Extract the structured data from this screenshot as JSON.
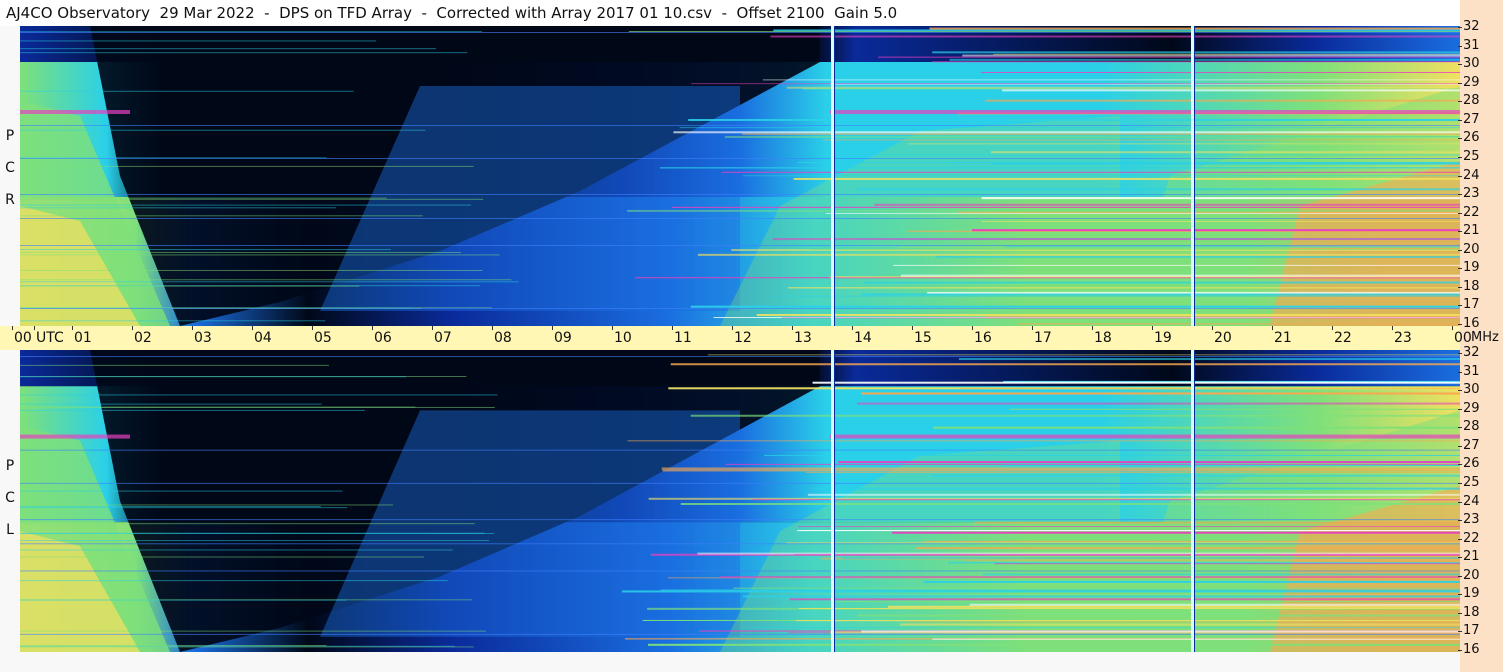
{
  "title": "AJ4CO Observatory  29 Mar 2022  -  DPS on TFD Array  -  Corrected with Array 2017 01 10.csv  -  Offset 2100  Gain 5.0",
  "polarizations": [
    {
      "name": "rcp",
      "letters": [
        "P",
        "C",
        "R"
      ]
    },
    {
      "name": "lcp",
      "letters": [
        "P",
        "C",
        "L"
      ]
    }
  ],
  "time_axis": {
    "utc_label": "UTC",
    "hours": [
      "00",
      "01",
      "02",
      "03",
      "04",
      "05",
      "06",
      "07",
      "08",
      "09",
      "10",
      "11",
      "12",
      "13",
      "14",
      "15",
      "16",
      "17",
      "18",
      "19",
      "20",
      "21",
      "22",
      "23",
      "00"
    ],
    "mhz_unit": "MHz"
  },
  "frequency_ticks": [
    "32",
    "31",
    "30",
    "29",
    "28",
    "27",
    "26",
    "25",
    "24",
    "23",
    "22",
    "21",
    "20",
    "19",
    "18",
    "17",
    "16"
  ],
  "palette": {
    "background": "#000818",
    "deep_blue": "#0a2a9a",
    "blue": "#1a6ee0",
    "cyan": "#2ad0e8",
    "green": "#7ee07a",
    "yellow": "#f0e060",
    "orange": "#f8a850",
    "magenta": "#e840c0",
    "axis_band": "#fff7b3",
    "scale_band": "#fde1c6"
  }
}
